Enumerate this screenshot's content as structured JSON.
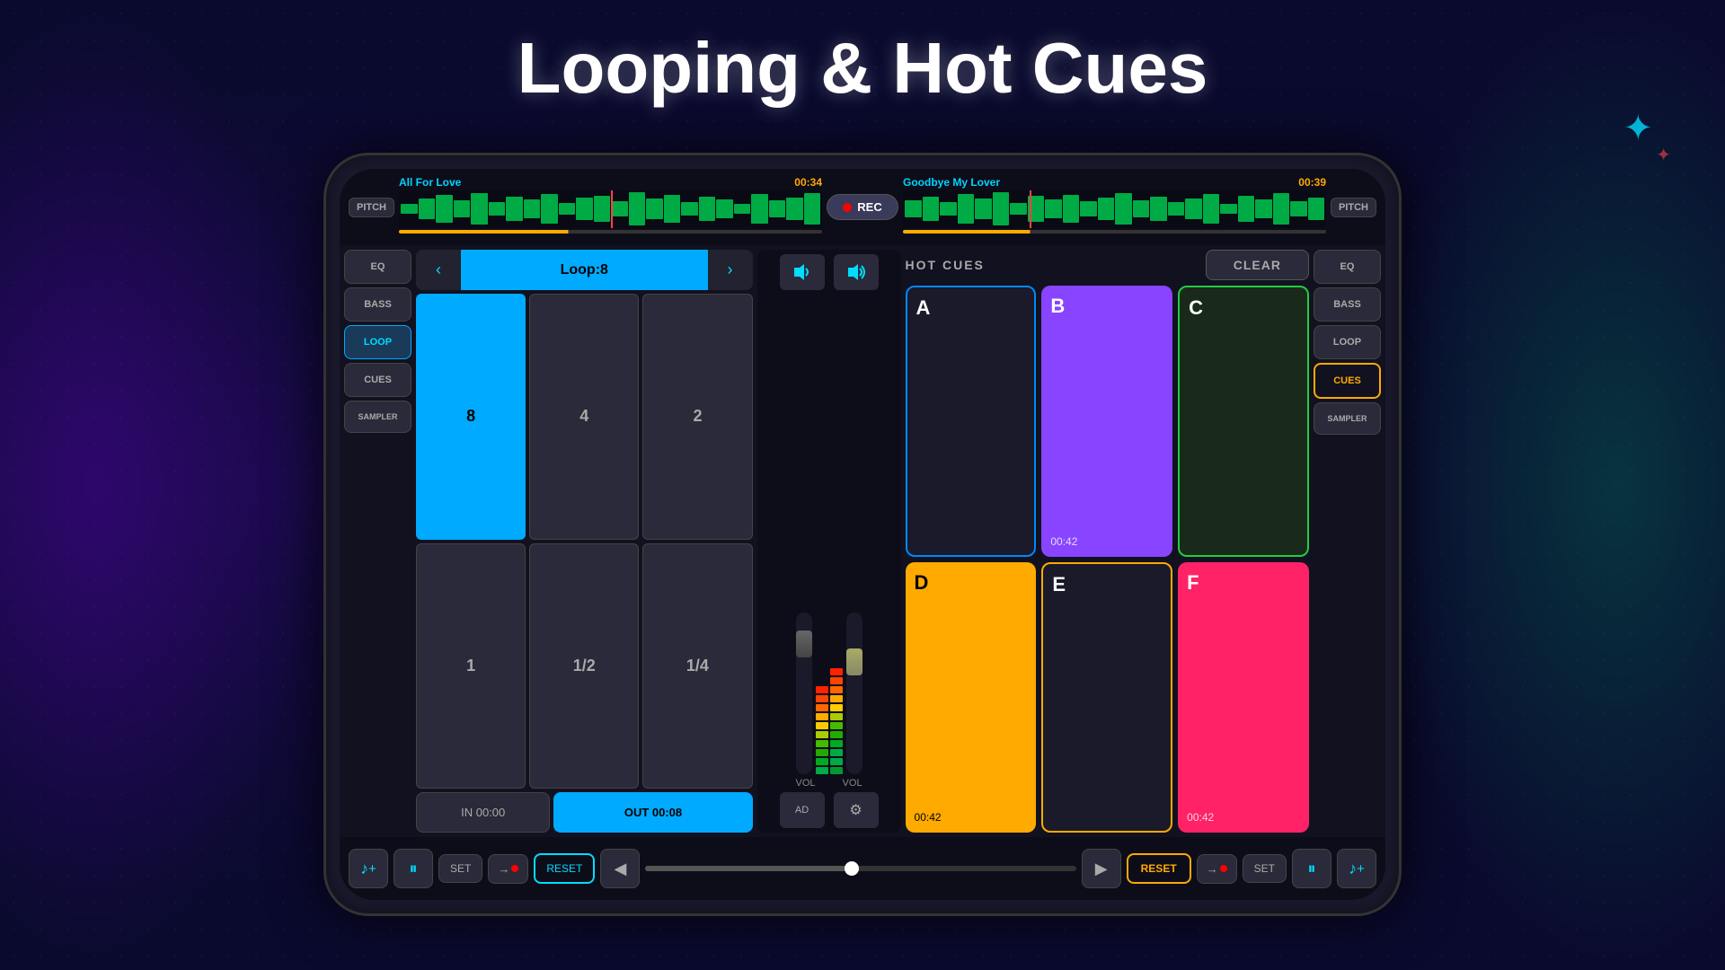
{
  "title": "Looping & Hot Cues",
  "background": {
    "color": "#0a0a2e"
  },
  "phone": {
    "waveform": {
      "left_track": "All For Love",
      "left_time": "00:34",
      "right_track": "Goodbye My Lover",
      "right_time": "00:39",
      "rec_label": "REC"
    },
    "left_sidebar": {
      "eq": "EQ",
      "bass": "BASS",
      "loop": "LOOP",
      "cues": "CUES",
      "sampler": "SAMPLER"
    },
    "loop_panel": {
      "loop_display": "Loop:8",
      "values": [
        "8",
        "4",
        "2",
        "1",
        "1/2",
        "1/4"
      ],
      "in_label": "IN  00:00",
      "out_label": "OUT  00:08"
    },
    "hot_cues": {
      "title": "HOT CUES",
      "clear": "CLEAR",
      "pads": [
        {
          "letter": "A",
          "time": "",
          "style": "blue-border empty"
        },
        {
          "letter": "B",
          "time": "00:42",
          "style": "purple"
        },
        {
          "letter": "C",
          "time": "",
          "style": "green-border empty"
        },
        {
          "letter": "D",
          "time": "00:42",
          "style": "yellow"
        },
        {
          "letter": "E",
          "time": "",
          "style": "dark"
        },
        {
          "letter": "F",
          "time": "00:42",
          "style": "pink"
        }
      ]
    },
    "right_sidebar": {
      "eq": "EQ",
      "bass": "BASS",
      "loop": "LOOP",
      "cues": "CUES",
      "sampler": "SAMPLER"
    },
    "transport_left": {
      "music": "♪+",
      "pause": "⏸",
      "set": "SET",
      "arrow_dot": "→",
      "reset": "RESET"
    },
    "transport_right": {
      "reset": "RESET",
      "arrow_dot": "→",
      "set": "SET",
      "pause": "⏸",
      "music": "♪+"
    },
    "vol_label": "VOL"
  }
}
